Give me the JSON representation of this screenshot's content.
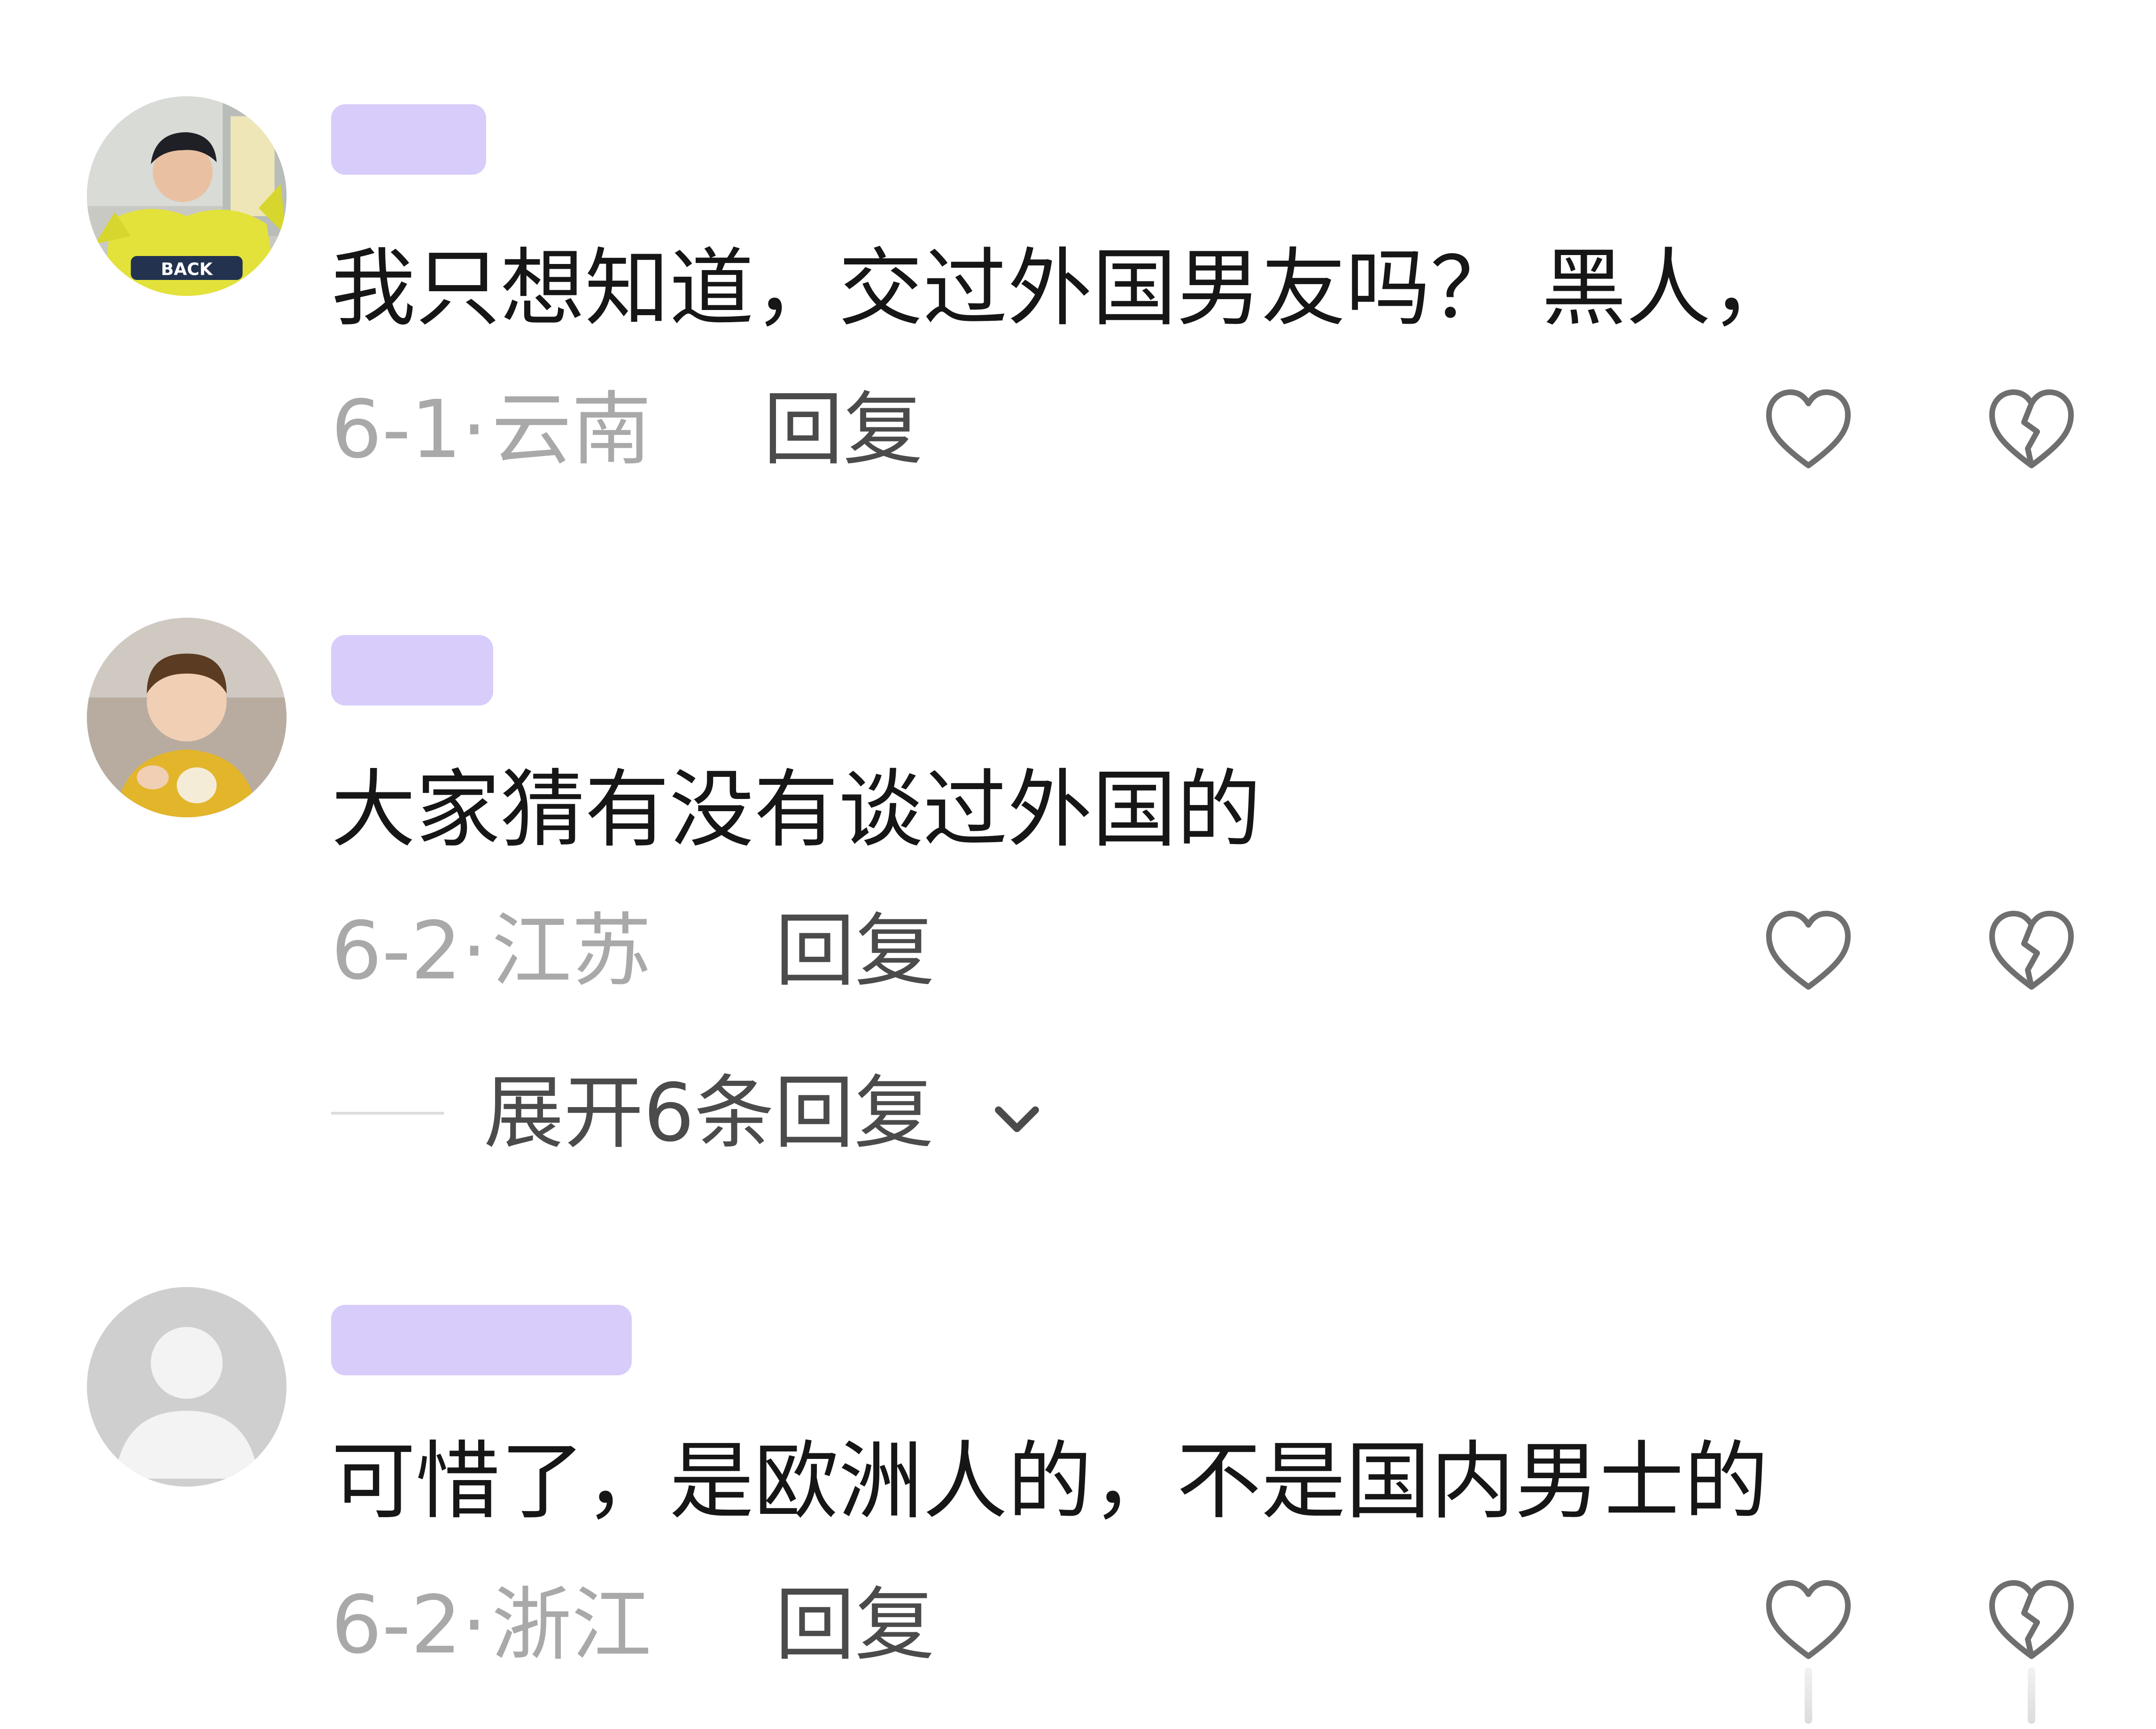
{
  "colors": {
    "username_redaction": "#d8ccfa",
    "meta_gray": "#a9a9a9",
    "action_gray": "#4b4b4b",
    "icon_gray": "#6f6f6f",
    "text": "#161616"
  },
  "comments": [
    {
      "avatar": "avatar-boy-yellow-jacket-back",
      "text": "我只想知道，交过外国男友吗？  黑人，",
      "date": "6-1",
      "sep": "·",
      "region": "云南",
      "reply_label": "回复",
      "like_icon": "heart-outline-icon",
      "dislike_icon": "broken-heart-icon"
    },
    {
      "avatar": "avatar-toddler-yellow-shirt",
      "text": "大家猜有没有谈过外国的",
      "date": "6-2",
      "sep": "·",
      "region": "江苏",
      "reply_label": "回复",
      "like_icon": "heart-outline-icon",
      "dislike_icon": "broken-heart-icon",
      "expand_label": "展开6条回复"
    },
    {
      "avatar": "avatar-default-placeholder",
      "text": "可惜了，是欧洲人的，不是国内男士的",
      "date": "6-2",
      "sep": "·",
      "region": "浙江",
      "reply_label": "回复",
      "like_icon": "heart-outline-icon",
      "dislike_icon": "broken-heart-icon"
    }
  ]
}
